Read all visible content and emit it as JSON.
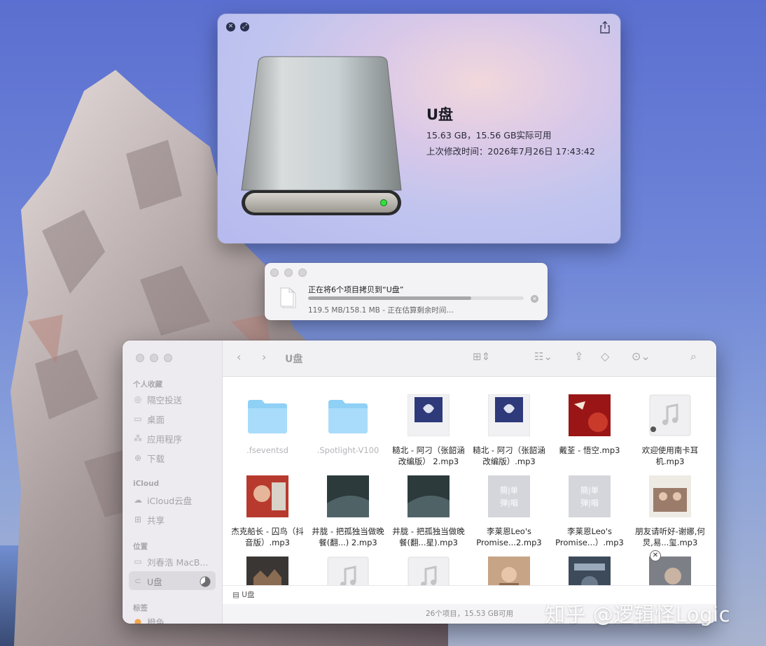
{
  "quicklook": {
    "title": "U盘",
    "capacity": "15.63 GB，15.56 GB实际可用",
    "modified": "上次修改时间：2026年7月26日 17:43:42"
  },
  "copy": {
    "title": "正在将6个项目拷贝到“U盘”",
    "status": "119.5 MB/158.1 MB - 正在估算剩余时间…",
    "progress": 0.756
  },
  "finder": {
    "title": "U盘",
    "sidebar": {
      "favorites_head": "个人收藏",
      "favorites": [
        "隔空投送",
        "桌面",
        "应用程序",
        "下载"
      ],
      "icloud_head": "iCloud",
      "icloud": [
        "iCloud云盘",
        "共享"
      ],
      "locations_head": "位置",
      "locations": [
        "刘春浩 MacB...",
        "U盘"
      ],
      "tags_head": "标签",
      "tags": [
        "橙色"
      ]
    },
    "files": [
      {
        "name": ".fseventsd"
      },
      {
        "name": ".Spotlight-V100"
      },
      {
        "name": "糙北 - 阿刁（张韶涵改编版） 2.mp3"
      },
      {
        "name": "糙北 - 阿刁（张韶涵改编版）.mp3"
      },
      {
        "name": "戴荃 - 悟空.mp3"
      },
      {
        "name": "欢迎使用南卡耳机.mp3"
      },
      {
        "name": "杰克船长 - 囚鸟（抖音版）.mp3"
      },
      {
        "name": "井胧 - 把孤独当做晚餐(翻...) 2.mp3"
      },
      {
        "name": "井胧 - 把孤独当做晚餐(翻...星).mp3"
      },
      {
        "name": "李莱恩Leo's Promise...2.mp3"
      },
      {
        "name": "李莱恩Leo's Promise...）.mp3"
      },
      {
        "name": "朋友请听好-谢娜,何炅,易...玺.mp3"
      }
    ],
    "thumb_text": "簡|単 弾|唱",
    "path": "U盘",
    "status": "26个项目，15.53 GB可用"
  },
  "watermark": "知乎 @逻辑怪Logic"
}
